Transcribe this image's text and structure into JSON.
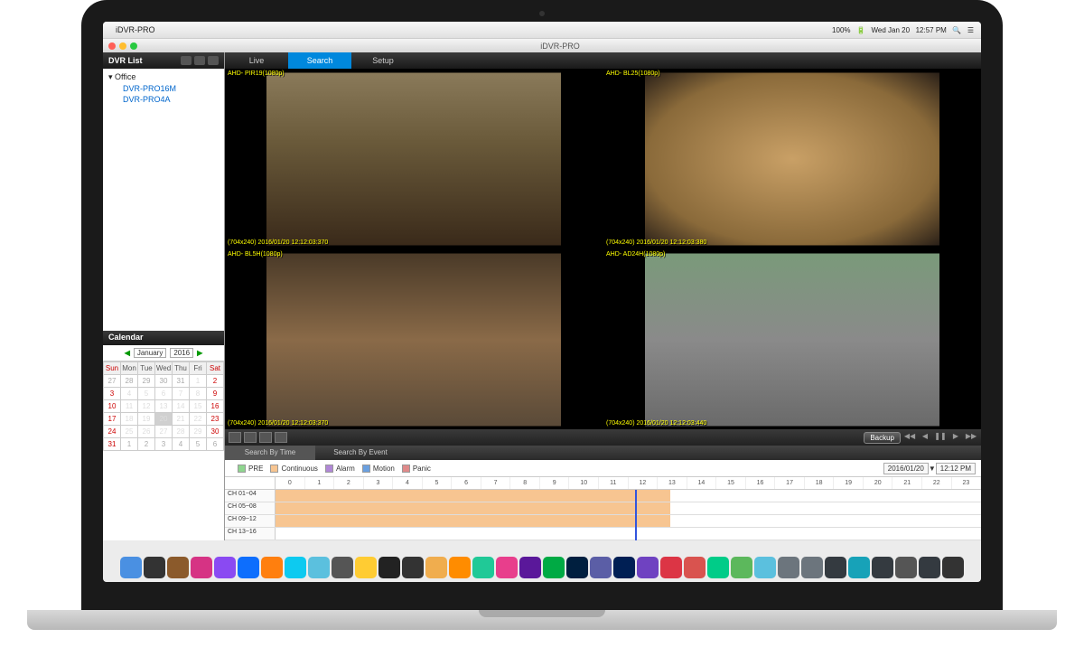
{
  "mac_menu": {
    "app_name": "iDVR-PRO",
    "battery": "100%",
    "date": "Wed Jan 20",
    "time": "12:57 PM"
  },
  "window": {
    "title": "iDVR-PRO"
  },
  "sidebar": {
    "header": "DVR List",
    "root": "Office",
    "items": [
      "DVR-PRO16M",
      "DVR-PRO4A"
    ]
  },
  "calendar": {
    "header": "Calendar",
    "month": "January",
    "year": "2016",
    "days": [
      "Sun",
      "Mon",
      "Tue",
      "Wed",
      "Thu",
      "Fri",
      "Sat"
    ],
    "weeks": [
      [
        {
          "d": 27,
          "o": 1
        },
        {
          "d": 28,
          "o": 1
        },
        {
          "d": 29,
          "o": 1
        },
        {
          "d": 30,
          "o": 1
        },
        {
          "d": 31,
          "o": 1
        },
        {
          "d": 1
        },
        {
          "d": 2
        }
      ],
      [
        {
          "d": 3
        },
        {
          "d": 4
        },
        {
          "d": 5
        },
        {
          "d": 6
        },
        {
          "d": 7
        },
        {
          "d": 8
        },
        {
          "d": 9
        }
      ],
      [
        {
          "d": 10
        },
        {
          "d": 11
        },
        {
          "d": 12
        },
        {
          "d": 13
        },
        {
          "d": 14
        },
        {
          "d": 15
        },
        {
          "d": 16
        }
      ],
      [
        {
          "d": 17
        },
        {
          "d": 18
        },
        {
          "d": 19
        },
        {
          "d": 20,
          "sel": 1
        },
        {
          "d": 21
        },
        {
          "d": 22
        },
        {
          "d": 23
        }
      ],
      [
        {
          "d": 24
        },
        {
          "d": 25
        },
        {
          "d": 26
        },
        {
          "d": 27
        },
        {
          "d": 28
        },
        {
          "d": 29
        },
        {
          "d": 30
        }
      ],
      [
        {
          "d": 31
        },
        {
          "d": 1,
          "o": 1
        },
        {
          "d": 2,
          "o": 1
        },
        {
          "d": 3,
          "o": 1
        },
        {
          "d": 4,
          "o": 1
        },
        {
          "d": 5,
          "o": 1
        },
        {
          "d": 6,
          "o": 1
        }
      ]
    ]
  },
  "tabs": {
    "live": "Live",
    "search": "Search",
    "setup": "Setup"
  },
  "cameras": [
    {
      "name_top": "AHD-\nPIR19(1080p)",
      "name_bot": "(704x240)\n2016/01/20 12:12:03:370"
    },
    {
      "name_top": "AHD-\nBL25(1080p)",
      "name_bot": "(704x240)\n2016/01/20 12:12:03:380"
    },
    {
      "name_top": "AHD-\nBL5H(1080p)",
      "name_bot": "(704x240)\n2016/01/20 12:12:03:370"
    },
    {
      "name_top": "AHD-\nAD24H(1080p)",
      "name_bot": "(704x240)\n2016/01/20 12:12:03:440"
    }
  ],
  "controls": {
    "backup": "Backup"
  },
  "search_tabs": {
    "by_time": "Search By Time",
    "by_event": "Search By Event"
  },
  "legend": {
    "items": [
      {
        "label": "PRE",
        "color": "#8fd68f"
      },
      {
        "label": "Continuous",
        "color": "#f7c591"
      },
      {
        "label": "Alarm",
        "color": "#b087d6"
      },
      {
        "label": "Motion",
        "color": "#6aa0e0"
      },
      {
        "label": "Panic",
        "color": "#e08a8a"
      }
    ],
    "date": "2016/01/20",
    "time": "12:12 PM"
  },
  "timeline": {
    "channels": [
      "CH 01~04",
      "CH 05~08",
      "CH 09~12",
      "CH 13~16"
    ],
    "hours": [
      "0",
      "1",
      "2",
      "3",
      "4",
      "5",
      "6",
      "7",
      "8",
      "9",
      "10",
      "11",
      "12",
      "13",
      "14",
      "15",
      "16",
      "17",
      "18",
      "19",
      "20",
      "21",
      "22",
      "23"
    ],
    "segments": [
      {
        "ch": 0,
        "start": 0,
        "end": 56
      },
      {
        "ch": 1,
        "start": 0,
        "end": 56
      },
      {
        "ch": 2,
        "start": 0,
        "end": 56
      }
    ],
    "playhead_pct": 51
  },
  "dock_colors": [
    "#4a90e2",
    "#333",
    "#8b5a2b",
    "#d63384",
    "#8a4af2",
    "#0d6efd",
    "#ff7f0e",
    "#0dcaf0",
    "#5bc0de",
    "#555",
    "#fc3",
    "#222",
    "#333",
    "#f0ad4e",
    "#ff8c00",
    "#20c997",
    "#e83e8c",
    "#5a189a",
    "#0a4",
    "#001f3f",
    "#5b5ea6",
    "#001f54",
    "#6f42c1",
    "#dc3545",
    "#d9534f",
    "#0c8",
    "#5cb85c",
    "#5bc0de",
    "#6c757d",
    "#6c757d",
    "#343a40",
    "#17a2b8",
    "#343a40",
    "#555",
    "#343a40",
    "#333"
  ]
}
